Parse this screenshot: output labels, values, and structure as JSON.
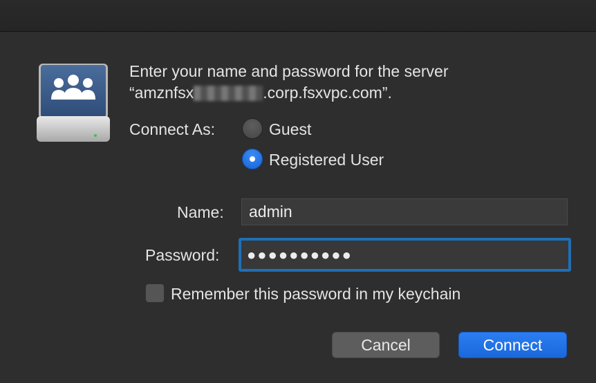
{
  "dialog": {
    "prompt_line1": "Enter your name and password for the server",
    "prompt_server_prefix": "“amznfsx",
    "prompt_server_suffix": ".corp.fsxvpc.com”.",
    "connect_as_label": "Connect As:",
    "options": {
      "guest": "Guest",
      "registered": "Registered User",
      "selected": "Registered User"
    },
    "name_label": "Name:",
    "name_value": "admin",
    "password_label": "Password:",
    "password_value": "●●●●●●●●●●",
    "remember_label": "Remember this password in my keychain",
    "remember_checked": false,
    "cancel_label": "Cancel",
    "connect_label": "Connect"
  },
  "icons": {
    "server": "server-drive-icon"
  },
  "colors": {
    "accent": "#1a68dc",
    "background": "#2e2e2e"
  }
}
